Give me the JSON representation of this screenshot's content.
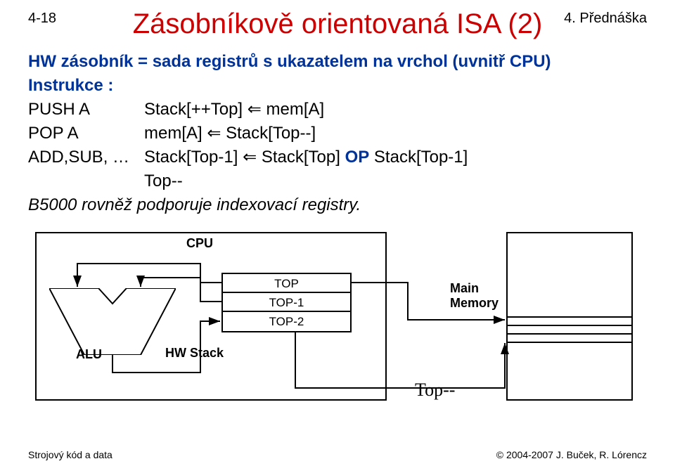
{
  "header": {
    "page_number": "4-18",
    "lecture_label": "4. Přednáška"
  },
  "title": "Zásobníkově orientovaná ISA (2)",
  "subtitle": "HW zásobník = sada registrů s ukazatelem na vrchol (uvnitř CPU)",
  "instr_heading": "Instrukce :",
  "instructions": {
    "push": {
      "label": "PUSH A",
      "rhs": "Stack[++Top] ⇐ mem[A]"
    },
    "pop": {
      "label": "POP A",
      "rhs": "mem[A] ⇐ Stack[Top--]"
    },
    "arith": {
      "label": "ADD,SUB, …",
      "rhs_pre": "Stack[Top-1] ⇐ Stack[Top] ",
      "rhs_op": "OP",
      "rhs_post": " Stack[Top-1]"
    },
    "arith_line2": "Top--"
  },
  "note": "B5000 rovněž podporuje indexovací registry.",
  "diagram": {
    "cpu_label": "CPU",
    "alu_label": "ALU",
    "regs": [
      "TOP",
      "TOP-1",
      "TOP-2"
    ],
    "hw_stack_label": "HW Stack",
    "mem_label_l1": "Main",
    "mem_label_l2": "Memory",
    "top_minus": "Top--"
  },
  "footer": {
    "left": "Strojový kód a data",
    "right": "© 2004-2007 J. Buček, R. Lórencz"
  }
}
